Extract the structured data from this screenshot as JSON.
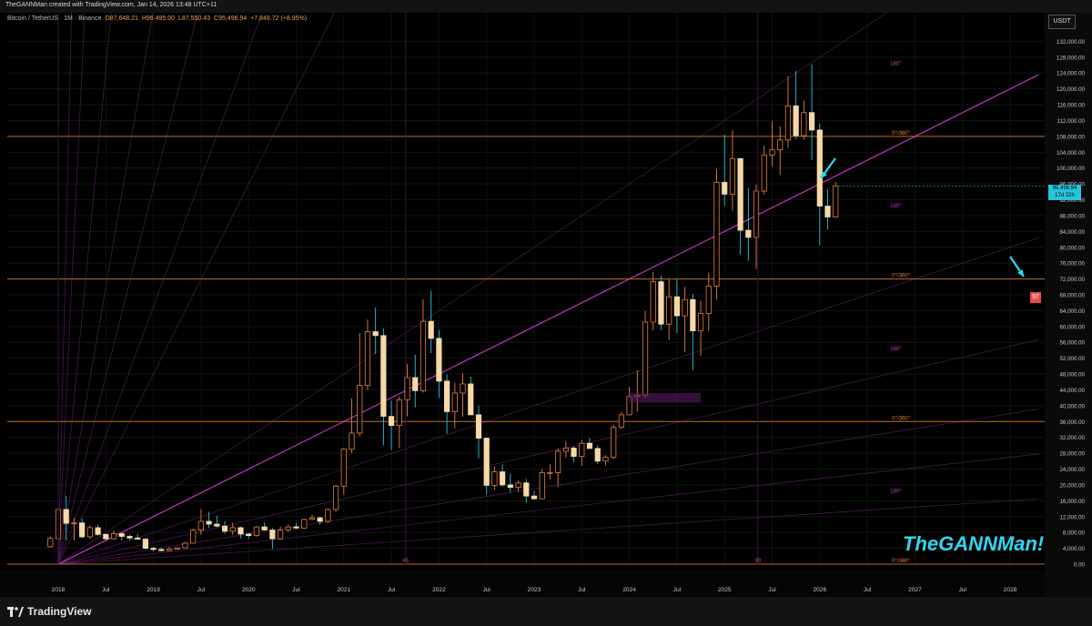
{
  "credit": "TheGANNMan created with TradingView.com, Jan 14, 2026 13:48 UTC+11",
  "symbol": {
    "name": "Bitcoin / TetherUS · 1M · Binance",
    "open": "O87,648.21",
    "high": "H96,495.00",
    "low": "L87,550.43",
    "close": "C95,496.94",
    "change": "+7,848.72 (+8.95%)"
  },
  "currency_badge": "USDT",
  "price_tag": {
    "price": "95,496.94",
    "countdown": "17d 22h"
  },
  "alert_badge": "97",
  "watermark": "TheGANNMan!",
  "brand": "TradingView",
  "colors": {
    "up": "#f7d9a6",
    "down": "#f7d9a6",
    "fan": "#d13ad6",
    "hline": "#e2822f",
    "arrow": "#2fd6f0"
  },
  "chart_data": {
    "type": "candlestick",
    "y_axis_labels": [
      "132,000.00",
      "128,000.00",
      "124,000.00",
      "120,000.00",
      "116,000.00",
      "112,000.00",
      "108,000.00",
      "104,000.00",
      "100,000.00",
      "96,000.00",
      "92,000.00",
      "88,000.00",
      "84,000.00",
      "80,000.00",
      "76,000.00",
      "72,000.00",
      "68,000.00",
      "64,000.00",
      "60,000.00",
      "56,000.00",
      "52,000.00",
      "48,000.00",
      "44,000.00",
      "40,000.00",
      "36,000.00",
      "32,000.00",
      "28,000.00",
      "24,000.00",
      "20,000.00",
      "16,000.00",
      "12,000.00",
      "8,000.00",
      "4,000.00",
      "0.00"
    ],
    "ylim": [
      0,
      136000
    ],
    "x_axis_labels": [
      {
        "t": 2018.0,
        "label": "2018"
      },
      {
        "t": 2018.5,
        "label": "Jul"
      },
      {
        "t": 2019.0,
        "label": "2019"
      },
      {
        "t": 2019.5,
        "label": "Jul"
      },
      {
        "t": 2020.0,
        "label": "2020"
      },
      {
        "t": 2020.5,
        "label": "Jul"
      },
      {
        "t": 2021.0,
        "label": "2021"
      },
      {
        "t": 2021.5,
        "label": "Jul"
      },
      {
        "t": 2022.0,
        "label": "2022"
      },
      {
        "t": 2022.5,
        "label": "Jul"
      },
      {
        "t": 2023.0,
        "label": "2023"
      },
      {
        "t": 2023.5,
        "label": "Jul"
      },
      {
        "t": 2024.0,
        "label": "2024"
      },
      {
        "t": 2024.5,
        "label": "Jul"
      },
      {
        "t": 2025.0,
        "label": "2025"
      },
      {
        "t": 2025.5,
        "label": "Jul"
      },
      {
        "t": 2026.0,
        "label": "2026"
      },
      {
        "t": 2026.5,
        "label": "Jul"
      },
      {
        "t": 2027.0,
        "label": "2027"
      },
      {
        "t": 2027.5,
        "label": "Jul"
      },
      {
        "t": 2028.0,
        "label": "2028"
      }
    ],
    "xlim": [
      2017.6,
      2028.3
    ],
    "horizontal_levels": [
      {
        "price": 108000,
        "label": "0°/360°"
      },
      {
        "price": 72000,
        "label": "0°/360°"
      },
      {
        "price": 36000,
        "label": "0°/360°"
      },
      {
        "price": 0,
        "label": "0°/360°"
      }
    ],
    "angle_labels": [
      {
        "t": 2026.8,
        "price": 126000,
        "label": "180°"
      },
      {
        "t": 2026.8,
        "price": 90000,
        "label": "180°"
      },
      {
        "t": 2026.8,
        "price": 54000,
        "label": "180°"
      },
      {
        "t": 2026.8,
        "price": 18000,
        "label": "180°"
      }
    ],
    "cycle_markers": [
      {
        "t": 2021.65,
        "label": "45"
      },
      {
        "t": 2025.35,
        "label": "90"
      }
    ],
    "fan_origin": {
      "t": 2018.0,
      "price": 0
    },
    "fan_slopes": [
      1000000,
      500000,
      250000,
      140000,
      95000,
      65000,
      48000,
      16000,
      12000,
      8000,
      5500,
      3800,
      2700,
      1600
    ],
    "main_fan_slope": 12000,
    "candles": [
      {
        "t": 2017.9167,
        "o": 4400,
        "h": 7000,
        "l": 4200,
        "c": 6500
      },
      {
        "t": 2018.0,
        "o": 6400,
        "h": 17000,
        "l": 6200,
        "c": 13800
      },
      {
        "t": 2018.0833,
        "o": 13800,
        "h": 17200,
        "l": 6000,
        "c": 10300
      },
      {
        "t": 2018.1667,
        "o": 10300,
        "h": 11700,
        "l": 6000,
        "c": 10400
      },
      {
        "t": 2018.25,
        "o": 10400,
        "h": 11500,
        "l": 6500,
        "c": 6900
      },
      {
        "t": 2018.3333,
        "o": 6900,
        "h": 9800,
        "l": 6400,
        "c": 9200
      },
      {
        "t": 2018.4167,
        "o": 9200,
        "h": 10000,
        "l": 7100,
        "c": 7500
      },
      {
        "t": 2018.5,
        "o": 7500,
        "h": 7800,
        "l": 5800,
        "c": 6400
      },
      {
        "t": 2018.5833,
        "o": 6400,
        "h": 8500,
        "l": 6100,
        "c": 7700
      },
      {
        "t": 2018.6667,
        "o": 7700,
        "h": 7800,
        "l": 5900,
        "c": 7000
      },
      {
        "t": 2018.75,
        "o": 7000,
        "h": 7400,
        "l": 6100,
        "c": 6600
      },
      {
        "t": 2018.8333,
        "o": 6600,
        "h": 7600,
        "l": 6200,
        "c": 6300
      },
      {
        "t": 2018.9167,
        "o": 6300,
        "h": 6600,
        "l": 3700,
        "c": 4000
      },
      {
        "t": 2019.0,
        "o": 4000,
        "h": 4300,
        "l": 3200,
        "c": 3700
      },
      {
        "t": 2019.0833,
        "o": 3700,
        "h": 4200,
        "l": 3300,
        "c": 3400
      },
      {
        "t": 2019.1667,
        "o": 3400,
        "h": 4300,
        "l": 3400,
        "c": 3800
      },
      {
        "t": 2019.25,
        "o": 3800,
        "h": 4200,
        "l": 3700,
        "c": 4100
      },
      {
        "t": 2019.3333,
        "o": 4100,
        "h": 5600,
        "l": 4000,
        "c": 5300
      },
      {
        "t": 2019.4167,
        "o": 5300,
        "h": 9000,
        "l": 5300,
        "c": 8600
      },
      {
        "t": 2019.5,
        "o": 8600,
        "h": 13900,
        "l": 7400,
        "c": 10800
      },
      {
        "t": 2019.5833,
        "o": 10800,
        "h": 13200,
        "l": 9100,
        "c": 10100
      },
      {
        "t": 2019.6667,
        "o": 10100,
        "h": 12300,
        "l": 9300,
        "c": 9600
      },
      {
        "t": 2019.75,
        "o": 9600,
        "h": 10900,
        "l": 7700,
        "c": 8300
      },
      {
        "t": 2019.8333,
        "o": 8300,
        "h": 10400,
        "l": 7300,
        "c": 9200
      },
      {
        "t": 2019.9167,
        "o": 9200,
        "h": 9500,
        "l": 6500,
        "c": 7600
      },
      {
        "t": 2020.0,
        "o": 7600,
        "h": 7900,
        "l": 6400,
        "c": 7200
      },
      {
        "t": 2020.0833,
        "o": 7200,
        "h": 9600,
        "l": 6900,
        "c": 9400
      },
      {
        "t": 2020.1667,
        "o": 9400,
        "h": 10500,
        "l": 8500,
        "c": 8600
      },
      {
        "t": 2020.25,
        "o": 8600,
        "h": 9200,
        "l": 3800,
        "c": 6400
      },
      {
        "t": 2020.3333,
        "o": 6400,
        "h": 9500,
        "l": 6200,
        "c": 8600
      },
      {
        "t": 2020.4167,
        "o": 8600,
        "h": 10000,
        "l": 8100,
        "c": 9400
      },
      {
        "t": 2020.5,
        "o": 9400,
        "h": 10400,
        "l": 8900,
        "c": 9100
      },
      {
        "t": 2020.5833,
        "o": 9100,
        "h": 11500,
        "l": 9000,
        "c": 11300
      },
      {
        "t": 2020.6667,
        "o": 11300,
        "h": 12500,
        "l": 11100,
        "c": 11700
      },
      {
        "t": 2020.75,
        "o": 11700,
        "h": 12000,
        "l": 9900,
        "c": 10800
      },
      {
        "t": 2020.8333,
        "o": 10800,
        "h": 14100,
        "l": 10400,
        "c": 13800
      },
      {
        "t": 2020.9167,
        "o": 13800,
        "h": 19900,
        "l": 13200,
        "c": 19700
      },
      {
        "t": 2021.0,
        "o": 19700,
        "h": 29300,
        "l": 17600,
        "c": 29000
      },
      {
        "t": 2021.0833,
        "o": 29000,
        "h": 41900,
        "l": 28100,
        "c": 33100
      },
      {
        "t": 2021.1667,
        "o": 33100,
        "h": 58300,
        "l": 32300,
        "c": 45100
      },
      {
        "t": 2021.25,
        "o": 45100,
        "h": 61800,
        "l": 44000,
        "c": 58700
      },
      {
        "t": 2021.3333,
        "o": 58700,
        "h": 64800,
        "l": 53000,
        "c": 57700
      },
      {
        "t": 2021.4167,
        "o": 57700,
        "h": 59500,
        "l": 30000,
        "c": 37300
      },
      {
        "t": 2021.5,
        "o": 37300,
        "h": 41300,
        "l": 28800,
        "c": 35000
      },
      {
        "t": 2021.5833,
        "o": 35000,
        "h": 42400,
        "l": 29300,
        "c": 41500
      },
      {
        "t": 2021.6667,
        "o": 41500,
        "h": 50500,
        "l": 37300,
        "c": 47100
      },
      {
        "t": 2021.75,
        "o": 47100,
        "h": 52900,
        "l": 39600,
        "c": 43800
      },
      {
        "t": 2021.8333,
        "o": 43800,
        "h": 66900,
        "l": 43300,
        "c": 61300
      },
      {
        "t": 2021.9167,
        "o": 61300,
        "h": 69000,
        "l": 53300,
        "c": 57000
      },
      {
        "t": 2022.0,
        "o": 57000,
        "h": 59100,
        "l": 42000,
        "c": 46200
      },
      {
        "t": 2022.0833,
        "o": 46200,
        "h": 47900,
        "l": 32900,
        "c": 38500
      },
      {
        "t": 2022.1667,
        "o": 38500,
        "h": 45800,
        "l": 34300,
        "c": 43200
      },
      {
        "t": 2022.25,
        "o": 43200,
        "h": 48200,
        "l": 37200,
        "c": 45500
      },
      {
        "t": 2022.3333,
        "o": 45500,
        "h": 47400,
        "l": 37600,
        "c": 37700
      },
      {
        "t": 2022.4167,
        "o": 37700,
        "h": 40000,
        "l": 26700,
        "c": 31800
      },
      {
        "t": 2022.5,
        "o": 31800,
        "h": 31900,
        "l": 17600,
        "c": 19900
      },
      {
        "t": 2022.5833,
        "o": 19900,
        "h": 24700,
        "l": 18800,
        "c": 23300
      },
      {
        "t": 2022.6667,
        "o": 23300,
        "h": 25200,
        "l": 19500,
        "c": 20000
      },
      {
        "t": 2022.75,
        "o": 20000,
        "h": 22800,
        "l": 18100,
        "c": 19400
      },
      {
        "t": 2022.8333,
        "o": 19400,
        "h": 21100,
        "l": 18200,
        "c": 20500
      },
      {
        "t": 2022.9167,
        "o": 20500,
        "h": 21500,
        "l": 15500,
        "c": 17200
      },
      {
        "t": 2023.0,
        "o": 17200,
        "h": 18400,
        "l": 16300,
        "c": 16500
      },
      {
        "t": 2023.0833,
        "o": 16500,
        "h": 24000,
        "l": 16500,
        "c": 23100
      },
      {
        "t": 2023.1667,
        "o": 23100,
        "h": 25200,
        "l": 21400,
        "c": 23100
      },
      {
        "t": 2023.25,
        "o": 23100,
        "h": 29200,
        "l": 19500,
        "c": 28500
      },
      {
        "t": 2023.3333,
        "o": 28500,
        "h": 31000,
        "l": 26900,
        "c": 29300
      },
      {
        "t": 2023.4167,
        "o": 29300,
        "h": 29800,
        "l": 25800,
        "c": 27200
      },
      {
        "t": 2023.5,
        "o": 27200,
        "h": 31400,
        "l": 24800,
        "c": 30500
      },
      {
        "t": 2023.5833,
        "o": 30500,
        "h": 31800,
        "l": 29500,
        "c": 29200
      },
      {
        "t": 2023.6667,
        "o": 29200,
        "h": 30000,
        "l": 25300,
        "c": 26000
      },
      {
        "t": 2023.75,
        "o": 26000,
        "h": 27500,
        "l": 24900,
        "c": 27000
      },
      {
        "t": 2023.8333,
        "o": 27000,
        "h": 35200,
        "l": 26500,
        "c": 34500
      },
      {
        "t": 2023.9167,
        "o": 34500,
        "h": 38400,
        "l": 34100,
        "c": 37700
      },
      {
        "t": 2024.0,
        "o": 37700,
        "h": 44700,
        "l": 37600,
        "c": 42300
      },
      {
        "t": 2024.0833,
        "o": 42300,
        "h": 48900,
        "l": 38500,
        "c": 42600
      },
      {
        "t": 2024.1667,
        "o": 42600,
        "h": 63900,
        "l": 41900,
        "c": 61100
      },
      {
        "t": 2024.25,
        "o": 61100,
        "h": 73800,
        "l": 59000,
        "c": 71300
      },
      {
        "t": 2024.3333,
        "o": 71300,
        "h": 72800,
        "l": 59100,
        "c": 60600
      },
      {
        "t": 2024.4167,
        "o": 60600,
        "h": 71900,
        "l": 56500,
        "c": 67500
      },
      {
        "t": 2024.5,
        "o": 67500,
        "h": 71900,
        "l": 58400,
        "c": 62700
      },
      {
        "t": 2024.5833,
        "o": 62700,
        "h": 70000,
        "l": 53500,
        "c": 66800
      },
      {
        "t": 2024.6667,
        "o": 66800,
        "h": 68200,
        "l": 49000,
        "c": 58900
      },
      {
        "t": 2024.75,
        "o": 58900,
        "h": 66500,
        "l": 52500,
        "c": 63300
      },
      {
        "t": 2024.8333,
        "o": 63300,
        "h": 73600,
        "l": 58900,
        "c": 70200
      },
      {
        "t": 2024.9167,
        "o": 70200,
        "h": 99800,
        "l": 66800,
        "c": 96400
      },
      {
        "t": 2025.0,
        "o": 96400,
        "h": 108400,
        "l": 90500,
        "c": 93400
      },
      {
        "t": 2025.0833,
        "o": 93400,
        "h": 109600,
        "l": 89200,
        "c": 102400
      },
      {
        "t": 2025.1667,
        "o": 102400,
        "h": 102500,
        "l": 78200,
        "c": 84300
      },
      {
        "t": 2025.25,
        "o": 84300,
        "h": 95000,
        "l": 76600,
        "c": 82500
      },
      {
        "t": 2025.3333,
        "o": 82500,
        "h": 95800,
        "l": 74500,
        "c": 94200
      },
      {
        "t": 2025.4167,
        "o": 94200,
        "h": 105700,
        "l": 93300,
        "c": 103300
      },
      {
        "t": 2025.5,
        "o": 103300,
        "h": 111900,
        "l": 100300,
        "c": 104600
      },
      {
        "t": 2025.5833,
        "o": 104600,
        "h": 110500,
        "l": 98200,
        "c": 107100
      },
      {
        "t": 2025.6667,
        "o": 107100,
        "h": 123200,
        "l": 105100,
        "c": 115700
      },
      {
        "t": 2025.75,
        "o": 115700,
        "h": 124500,
        "l": 107300,
        "c": 108200
      },
      {
        "t": 2025.8333,
        "o": 108200,
        "h": 117000,
        "l": 107200,
        "c": 114000
      },
      {
        "t": 2025.9167,
        "o": 114000,
        "h": 126200,
        "l": 102000,
        "c": 109600
      },
      {
        "t": 2026.0,
        "o": 109600,
        "h": 111200,
        "l": 80500,
        "c": 90400
      },
      {
        "t": 2026.0833,
        "o": 90400,
        "h": 94600,
        "l": 84500,
        "c": 87648
      },
      {
        "t": 2026.1667,
        "o": 87648,
        "h": 96495,
        "l": 87550,
        "c": 95497
      }
    ]
  }
}
